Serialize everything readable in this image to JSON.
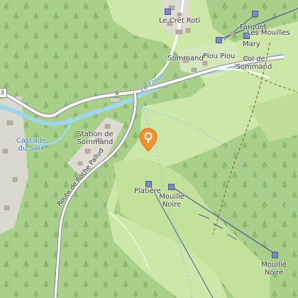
{
  "labels": {
    "le_cret_roti": "Le Crêt Roti",
    "farquet": "Farquet",
    "les_mouilles": "Les Mouilles",
    "mary": "Mary",
    "sommand": "Sommand",
    "piou_piou": "Piou Piou",
    "col_de_sommand": "Col de Sommand",
    "le_foron": "Le Foron",
    "cascade_du_saix": "Cascade du Saix",
    "station_de_sommand": "Station de Sommand",
    "route_de_roche_pallud": "Route de Roche Pallud",
    "platiere": "Platière",
    "mouille_noire_upper": "Mouille Noire",
    "mouille_noire_lower": "Mouille Noire",
    "road_badge": "3",
    "bridge_badge": "9"
  },
  "marker": {
    "icon": "location-pin-icon",
    "color": "#f39231"
  },
  "colors": {
    "forest": "#a9d08a",
    "meadow": "#cde7a8",
    "water": "#9ed6ea",
    "water_label": "#2f6fb0",
    "lift_line": "#4b5a93",
    "trail": "#8a6a3a"
  }
}
